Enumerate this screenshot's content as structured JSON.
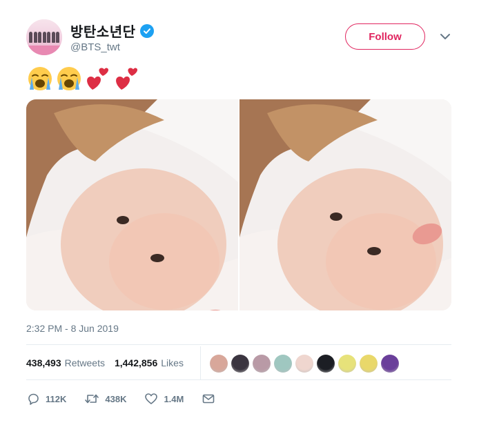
{
  "user": {
    "display_name": "방탄소년단",
    "handle": "@BTS_twt",
    "verified": true
  },
  "follow_label": "Follow",
  "tweet": {
    "emojis": [
      "loudly-crying-face",
      "loudly-crying-face",
      "heart-exclamation",
      "heart-exclamation"
    ],
    "timestamp": "2:32 PM - 8 Jun 2019"
  },
  "stats": {
    "retweets_count": "438,493",
    "retweets_label": "Retweets",
    "likes_count": "1,442,856",
    "likes_label": "Likes"
  },
  "likers": [
    {
      "color": "#d8a79a"
    },
    {
      "color": "#3b3540"
    },
    {
      "color": "#b99aa6"
    },
    {
      "color": "#9fc7c0"
    },
    {
      "color": "#efd6cf"
    },
    {
      "color": "#1c1e24"
    },
    {
      "color": "#e7e27a"
    },
    {
      "color": "#e9d86a"
    },
    {
      "color": "#6a3f9a"
    }
  ],
  "actions": {
    "reply_count": "112K",
    "retweet_count": "438K",
    "like_count": "1.4M"
  },
  "colors": {
    "accent": "#e0245e",
    "verified": "#1da1f2",
    "muted": "#657786",
    "text": "#14171a"
  }
}
